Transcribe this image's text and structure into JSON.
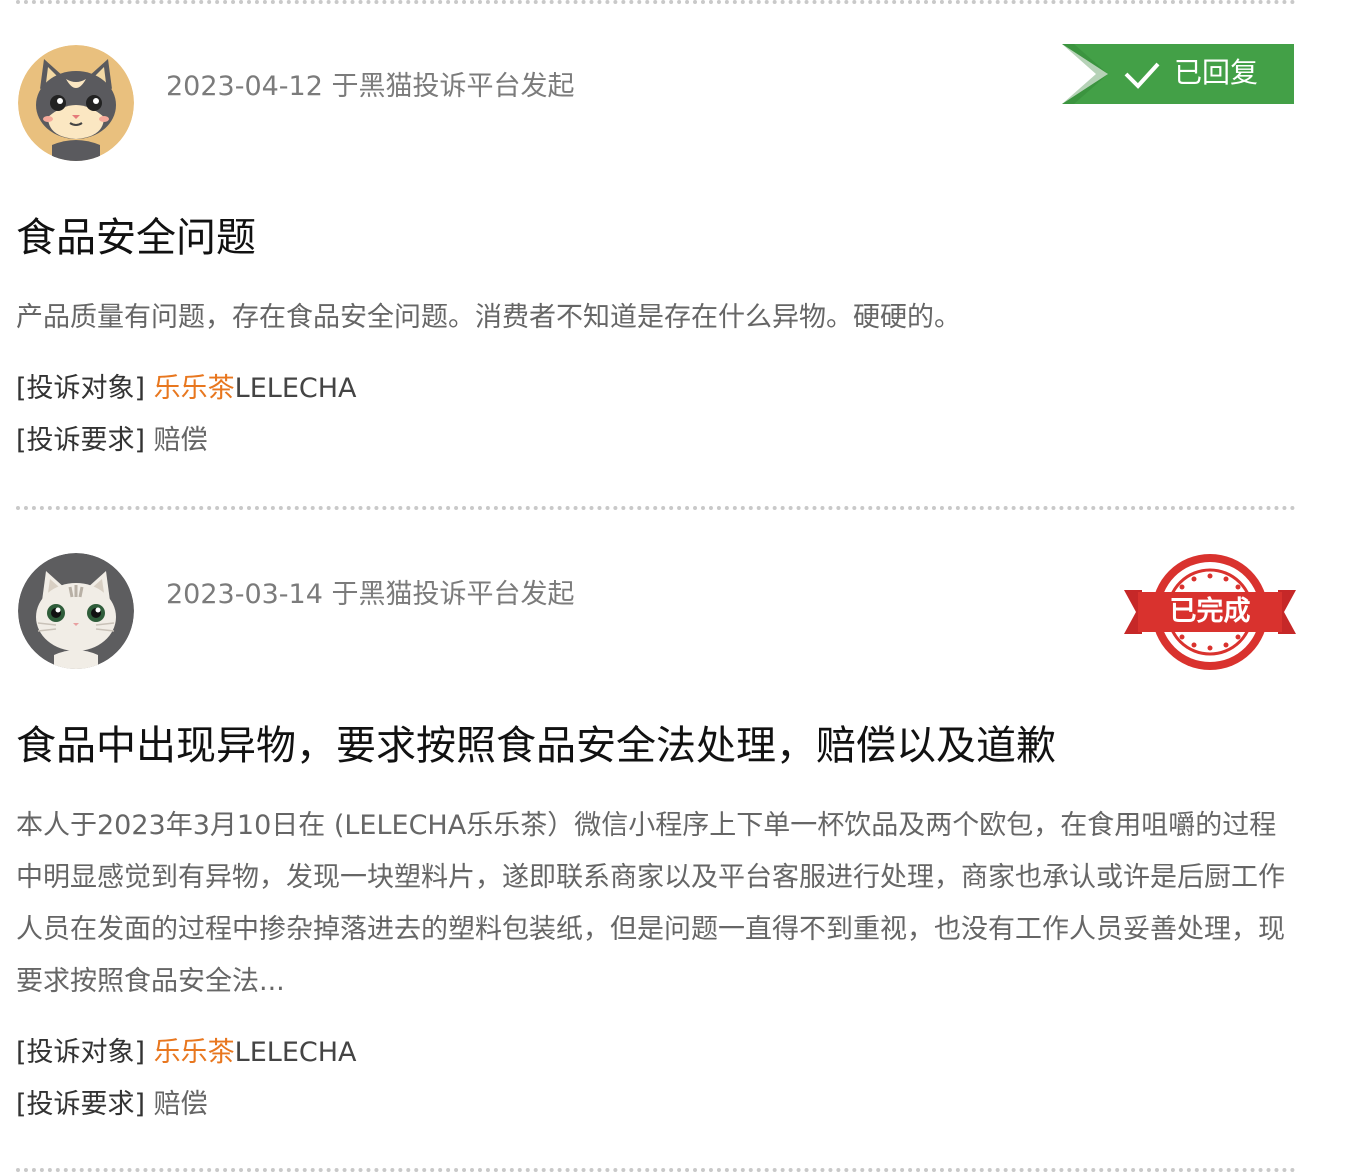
{
  "complaints": [
    {
      "date_source": "2023-04-12 于黑猫投诉平台发起",
      "status": "已回复",
      "status_color": "#43a047",
      "title": "食品安全问题",
      "description": "产品质量有问题，存在食品安全问题。消费者不知道是存在什么异物。硬硬的。",
      "target_label": "[投诉对象]",
      "target_brand_cn": "乐乐茶",
      "target_brand_en": "LELECHA",
      "request_label": "[投诉要求]",
      "request_value": "赔偿"
    },
    {
      "date_source": "2023-03-14 于黑猫投诉平台发起",
      "status": "已完成",
      "status_color": "#d32f2f",
      "title": "食品中出现异物，要求按照食品安全法处理，赔偿以及道歉",
      "description": "本人于2023年3月10日在 (LELECHA乐乐茶）微信小程序上下单一杯饮品及两个欧包，在食用咀嚼的过程中明显感觉到有异物，发现一块塑料片，遂即联系商家以及平台客服进行处理，商家也承认或许是后厨工作人员在发面的过程中掺杂掉落进去的塑料包装纸，但是问题一直得不到重视，也没有工作人员妥善处理，现要求按照食品安全法...",
      "target_label": "[投诉对象]",
      "target_brand_cn": "乐乐茶",
      "target_brand_en": "LELECHA",
      "request_label": "[投诉要求]",
      "request_value": "赔偿"
    }
  ],
  "brand_color": "#e8771f"
}
